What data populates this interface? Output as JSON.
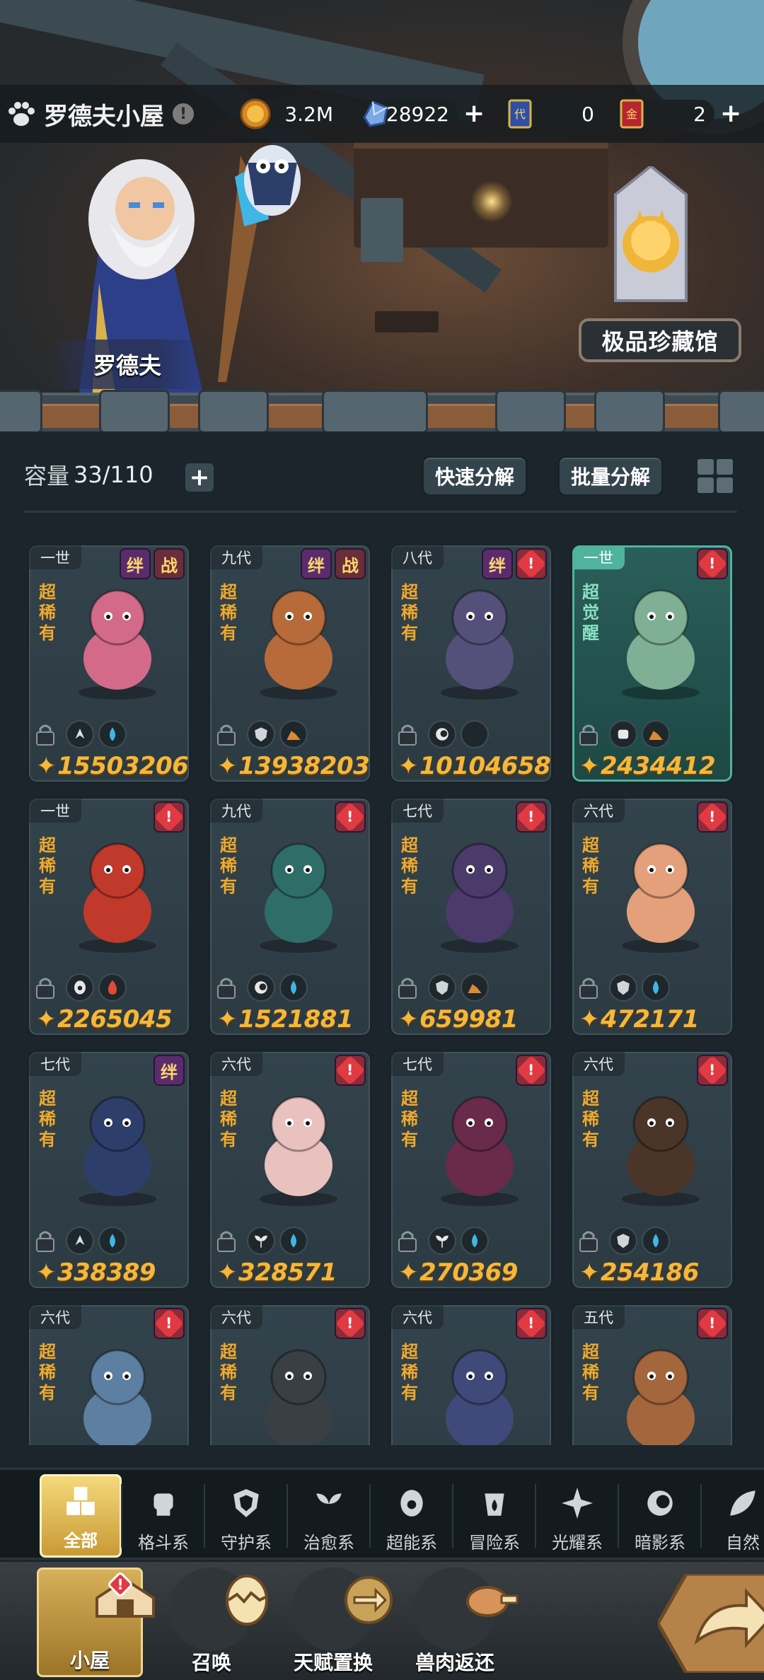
{
  "top_bar": {
    "house_title": "罗德夫小屋",
    "info_label": "!",
    "gold": "3.2M",
    "crystals": "28922",
    "ticket_dai": "0",
    "ticket_jin": "2",
    "plus": "+"
  },
  "scene": {
    "npc_name": "罗德夫",
    "collection_button": "极品珍藏馆"
  },
  "toolbar": {
    "capacity_label": "容量",
    "capacity_value": "33/110",
    "capacity_plus": "+",
    "quick_decompose": "快速分解",
    "batch_decompose": "批量分解"
  },
  "cards": [
    {
      "gen": "一世",
      "rarity": "超稀有",
      "badges": [
        "绊",
        "战"
      ],
      "alert": false,
      "elements": [
        "fight",
        "water"
      ],
      "power": "15503206",
      "art_color": "#d46a8a"
    },
    {
      "gen": "九代",
      "rarity": "超稀有",
      "badges": [
        "绊",
        "战"
      ],
      "alert": false,
      "elements": [
        "guard",
        "ground"
      ],
      "power": "13938203",
      "art_color": "#b76a3a"
    },
    {
      "gen": "八代",
      "rarity": "超稀有",
      "badges": [
        "绊"
      ],
      "alert": true,
      "elements": [
        "shadow",
        "moon"
      ],
      "power": "10104658",
      "art_color": "#55507a"
    },
    {
      "gen": "一世",
      "rarity": "超觉醒",
      "badges": [],
      "alert": true,
      "elements": [
        "fist",
        "ground"
      ],
      "power": "2434412",
      "art_color": "#7fb095",
      "awake": true
    },
    {
      "gen": "一世",
      "rarity": "超稀有",
      "badges": [],
      "alert": true,
      "elements": [
        "psychic",
        "fire"
      ],
      "power": "2265045",
      "art_color": "#c0392b"
    },
    {
      "gen": "九代",
      "rarity": "超稀有",
      "badges": [],
      "alert": true,
      "elements": [
        "shadow",
        "water"
      ],
      "power": "1521881",
      "art_color": "#2f6e68"
    },
    {
      "gen": "七代",
      "rarity": "超稀有",
      "badges": [],
      "alert": true,
      "elements": [
        "guard",
        "ground"
      ],
      "power": "659981",
      "art_color": "#4b3a6a"
    },
    {
      "gen": "六代",
      "rarity": "超稀有",
      "badges": [],
      "alert": true,
      "elements": [
        "guard",
        "water"
      ],
      "power": "472171",
      "art_color": "#e3a07a"
    },
    {
      "gen": "七代",
      "rarity": "超稀有",
      "badges": [
        "绊"
      ],
      "alert": false,
      "elements": [
        "fight",
        "water"
      ],
      "power": "338389",
      "art_color": "#2d3e6a"
    },
    {
      "gen": "六代",
      "rarity": "超稀有",
      "badges": [],
      "alert": true,
      "elements": [
        "heal",
        "water"
      ],
      "power": "328571",
      "art_color": "#e9c2c0"
    },
    {
      "gen": "七代",
      "rarity": "超稀有",
      "badges": [],
      "alert": true,
      "elements": [
        "heal",
        "water"
      ],
      "power": "270369",
      "art_color": "#6a2a4a"
    },
    {
      "gen": "六代",
      "rarity": "超稀有",
      "badges": [],
      "alert": true,
      "elements": [
        "guard",
        "water"
      ],
      "power": "254186",
      "art_color": "#4a3528"
    },
    {
      "gen": "六代",
      "rarity": "超稀有",
      "badges": [],
      "alert": true,
      "elements": [],
      "power": "",
      "art_color": "#5d7fa1"
    },
    {
      "gen": "六代",
      "rarity": "超稀有",
      "badges": [],
      "alert": true,
      "elements": [],
      "power": "",
      "art_color": "#3a3f44"
    },
    {
      "gen": "六代",
      "rarity": "超稀有",
      "badges": [],
      "alert": true,
      "elements": [],
      "power": "",
      "art_color": "#3f4a7a"
    },
    {
      "gen": "五代",
      "rarity": "超稀有",
      "badges": [],
      "alert": true,
      "elements": [],
      "power": "",
      "art_color": "#a3663d"
    }
  ],
  "categories": [
    {
      "label": "全部",
      "icon": "all-icon",
      "active": true
    },
    {
      "label": "格斗系",
      "icon": "fist-icon"
    },
    {
      "label": "守护系",
      "icon": "shield-icon"
    },
    {
      "label": "治愈系",
      "icon": "sprout-icon"
    },
    {
      "label": "超能系",
      "icon": "psychic-icon"
    },
    {
      "label": "冒险系",
      "icon": "lantern-icon"
    },
    {
      "label": "光耀系",
      "icon": "star-icon"
    },
    {
      "label": "暗影系",
      "icon": "shadow-icon"
    },
    {
      "label": "自然",
      "icon": "leaf-icon"
    }
  ],
  "bottom_nav": [
    {
      "label": "小屋",
      "icon": "house-icon",
      "active": true
    },
    {
      "label": "召唤",
      "icon": "egg-icon"
    },
    {
      "label": "天赋置换",
      "icon": "swap-icon"
    },
    {
      "label": "兽肉返还",
      "icon": "meat-icon"
    }
  ],
  "colors": {
    "accent_gold": "#f5b73a",
    "rarity_orange": "#f0a92c",
    "alert_red": "#e23a42",
    "awake_teal": "#4fb39d"
  }
}
